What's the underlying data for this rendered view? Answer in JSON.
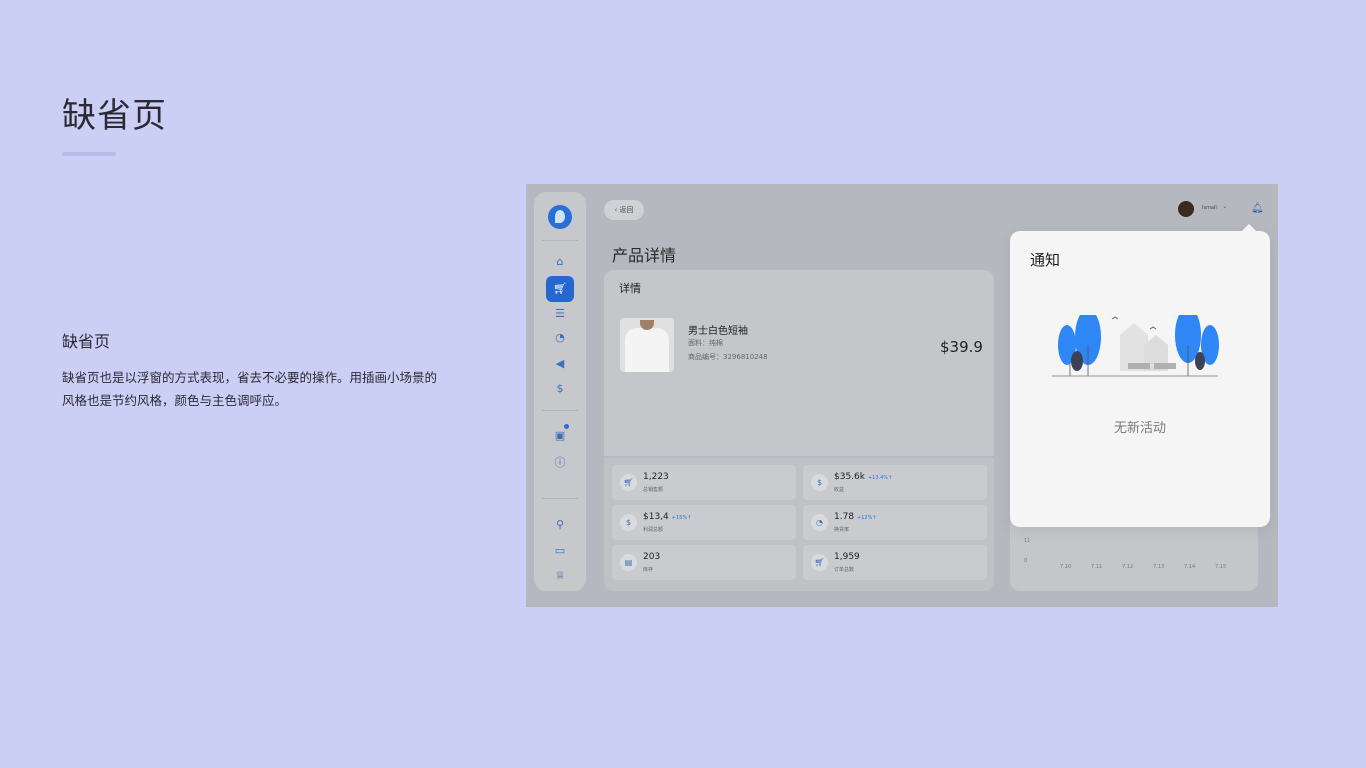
{
  "page": {
    "title": "缺省页",
    "section_title": "缺省页",
    "section_desc_line1": "缺省页也是以浮窗的方式表现，省去不必要的操作。用插画小场景的",
    "section_desc_line2": "风格也是节约风格，颜色与主色调呼应。"
  },
  "app": {
    "back_label": "‹ 返回",
    "page_title": "产品详情",
    "user_name": "Ismail",
    "sidebar_icons": [
      "logo",
      "home-icon",
      "cart-icon",
      "list-icon",
      "pie-chart-icon",
      "megaphone-icon",
      "dollar-icon",
      "inbox-icon",
      "info-icon",
      "plug-icon",
      "toggle-icon",
      "crown-icon"
    ]
  },
  "detail": {
    "label": "详情",
    "product_name": "男士白色短袖",
    "material": "面料：纯棉",
    "code": "商品编号：3296810248",
    "price": "$39.9"
  },
  "stats": [
    {
      "value": "1,223",
      "delta": "",
      "label": "总销售额",
      "icon": "cart-icon"
    },
    {
      "value": "$35.6k",
      "delta": "+13.4%↑",
      "label": "收益",
      "icon": "dollar-icon"
    },
    {
      "value": "$13,4",
      "delta": "+15%↑",
      "label": "利润总额",
      "icon": "dollar-icon"
    },
    {
      "value": "1.78",
      "delta": "+12%↑",
      "label": "换货率",
      "icon": "pie-chart-icon"
    },
    {
      "value": "203",
      "delta": "",
      "label": "库存",
      "icon": "box-icon"
    },
    {
      "value": "1,959",
      "delta": "",
      "label": "订单总数",
      "icon": "cart-icon"
    }
  ],
  "chart": {
    "x_ticks": [
      "7.10",
      "7.11",
      "7.12",
      "7.13",
      "7.14",
      "7.15"
    ],
    "y_ticks": [
      "11",
      "0"
    ]
  },
  "notification": {
    "title": "通知",
    "empty_text": "无新活动"
  },
  "colors": {
    "background": "#cbcff6",
    "accent": "#2467cf",
    "tree_blue": "#2f86f5"
  }
}
